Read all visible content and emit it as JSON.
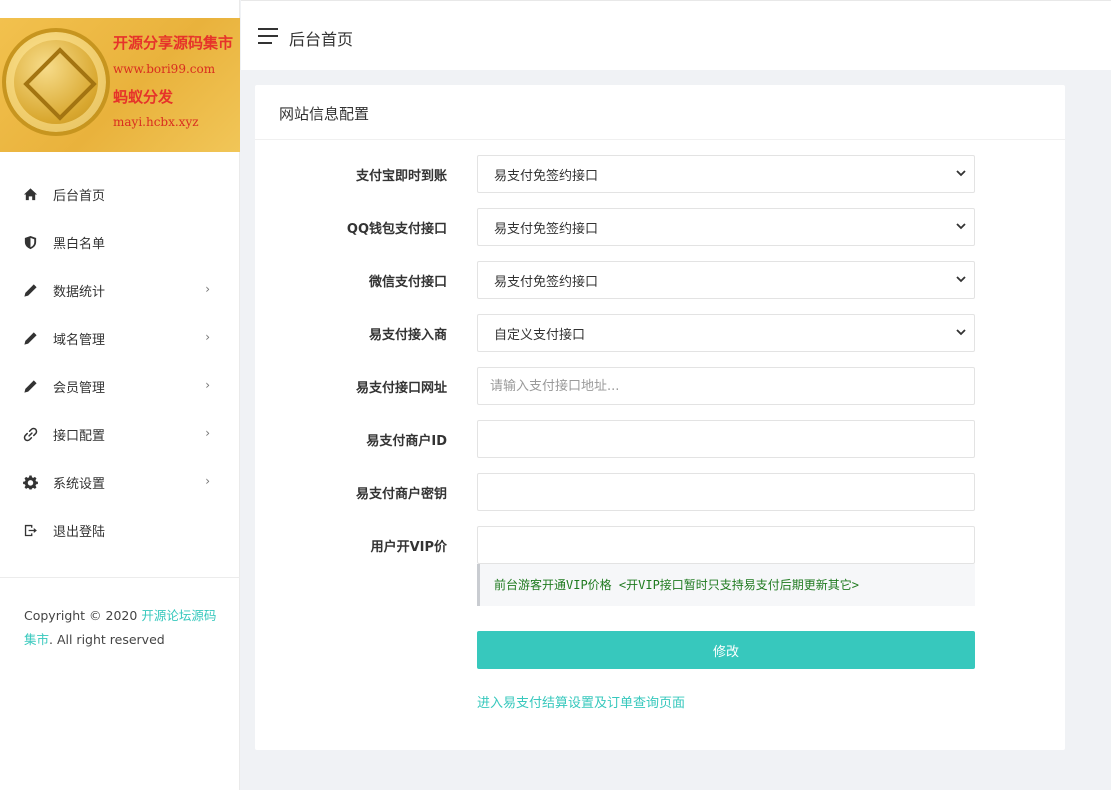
{
  "logo": {
    "line1": "开源分享源码集市",
    "line2": "www.bori99.com",
    "line3": "蚂蚁分发",
    "line4": "mayi.hcbx.xyz"
  },
  "sidebar": {
    "items": [
      {
        "label": "后台首页",
        "icon": "home-icon",
        "has_arrow": false
      },
      {
        "label": "黑白名单",
        "icon": "shield-icon",
        "has_arrow": false
      },
      {
        "label": "数据统计",
        "icon": "pencil-icon",
        "has_arrow": true
      },
      {
        "label": "域名管理",
        "icon": "pencil-icon",
        "has_arrow": true
      },
      {
        "label": "会员管理",
        "icon": "pencil-icon",
        "has_arrow": true
      },
      {
        "label": "接口配置",
        "icon": "link-icon",
        "has_arrow": true
      },
      {
        "label": "系统设置",
        "icon": "gear-icon",
        "has_arrow": true
      },
      {
        "label": "退出登陆",
        "icon": "logout-icon",
        "has_arrow": false
      }
    ],
    "arrow_glyph": "›",
    "copyright_prefix": "Copyright © 2020 ",
    "copyright_link": "开源论坛源码集市",
    "copyright_suffix": ". All right reserved"
  },
  "header": {
    "title": "后台首页"
  },
  "card": {
    "title": "网站信息配置",
    "fields": [
      {
        "label": "支付宝即时到账",
        "type": "select",
        "value": "易支付免签约接口"
      },
      {
        "label": "QQ钱包支付接口",
        "type": "select",
        "value": "易支付免签约接口"
      },
      {
        "label": "微信支付接口",
        "type": "select",
        "value": "易支付免签约接口"
      },
      {
        "label": "易支付接入商",
        "type": "select",
        "value": "自定义支付接口"
      },
      {
        "label": "易支付接口网址",
        "type": "input",
        "value": "",
        "placeholder": "请输入支付接口地址..."
      },
      {
        "label": "易支付商户ID",
        "type": "input",
        "value": "",
        "placeholder": ""
      },
      {
        "label": "易支付商户密钥",
        "type": "input",
        "value": "",
        "placeholder": ""
      },
      {
        "label": "用户开VIP价",
        "type": "input",
        "value": "",
        "placeholder": ""
      }
    ],
    "hint": "前台游客开通VIP价格 <开VIP接口暂时只支持易支付后期更新其它>",
    "submit_label": "修改",
    "footer_link": "进入易支付结算设置及订单查询页面"
  },
  "colors": {
    "accent": "#37c8bd",
    "hint_text": "#1f7a1f",
    "logo_red": "#e6332a"
  }
}
